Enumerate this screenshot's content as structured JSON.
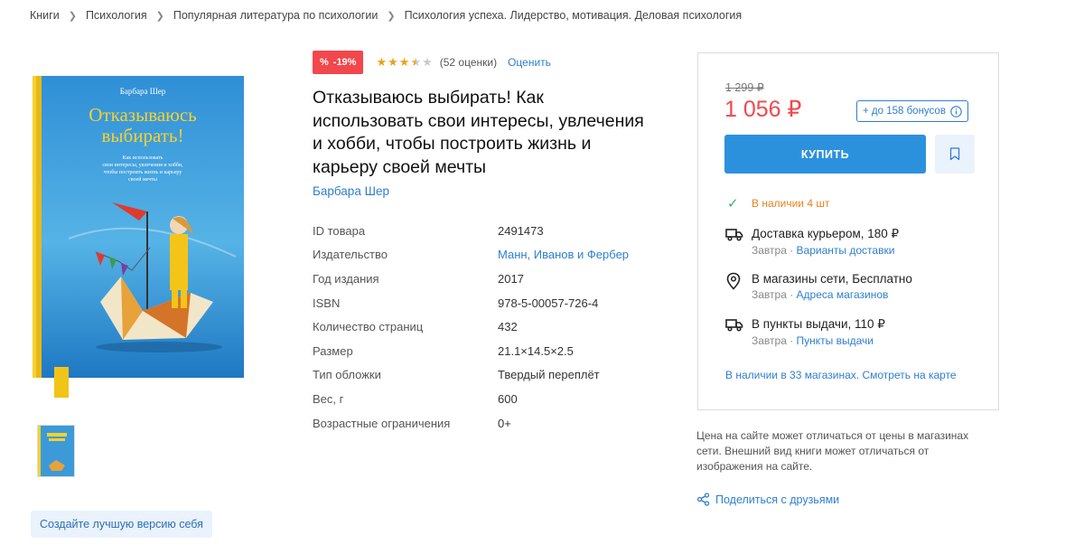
{
  "breadcrumbs": [
    "Книги",
    "Психология",
    "Популярная литература по психологии",
    "Психология успеха. Лидерство, мотивация. Деловая психология"
  ],
  "cover": {
    "author": "Барбара Шер",
    "title_line1": "Отказываюсь",
    "title_line2": "выбирать!",
    "subtitle_line1": "Как использовать",
    "subtitle_line2": "свои интересы, увлечения и хобби,",
    "subtitle_line3": "чтобы построить жизнь и карьеру",
    "subtitle_line4": "своей мечты"
  },
  "tag_button": "Создайте лучшую версию себя",
  "discount": "-19%",
  "rating": {
    "value": 3.5,
    "max": 5,
    "count_text": "(52 оценки)",
    "rate_label": "Оценить"
  },
  "title": "Отказываюсь выбирать! Как использовать свои интересы, увлечения и хобби, чтобы построить жизнь и карьеру своей мечты",
  "author": "Барбара Шер",
  "specs": [
    {
      "key": "ID товара",
      "value": "2491473",
      "link": false
    },
    {
      "key": "Издательство",
      "value": "Манн, Иванов и Фербер",
      "link": true
    },
    {
      "key": "Год издания",
      "value": "2017",
      "link": false
    },
    {
      "key": "ISBN",
      "value": "978-5-00057-726-4",
      "link": false
    },
    {
      "key": "Количество страниц",
      "value": "432",
      "link": false
    },
    {
      "key": "Размер",
      "value": "21.1×14.5×2.5",
      "link": false
    },
    {
      "key": "Тип обложки",
      "value": "Твердый переплёт",
      "link": false
    },
    {
      "key": "Вес, г",
      "value": "600",
      "link": false
    },
    {
      "key": "Возрастные ограничения",
      "value": "0+",
      "link": false
    }
  ],
  "buybox": {
    "old_price": "1 299 ₽",
    "price": "1 056 ₽",
    "bonus": "+ до 158 бонусов",
    "buy_label": "КУПИТЬ",
    "stock": "В наличии 4 шт",
    "delivery": [
      {
        "title": "Доставка курьером, 180 ₽",
        "when": "Завтра · ",
        "link": "Варианты доставки",
        "icon": "truck-icon"
      },
      {
        "title": "В магазины сети, Бесплатно",
        "when": "Завтра · ",
        "link": "Адреса магазинов",
        "icon": "location-pin-icon"
      },
      {
        "title": "В пункты выдачи, 110 ₽",
        "when": "Завтра · ",
        "link": "Пункты выдачи",
        "icon": "pickup-truck-icon"
      }
    ],
    "map_link": "В наличии в 33 магазинах. Смотреть на карте"
  },
  "note": "Цена на сайте может отличаться от цены в магазинах сети. Внешний вид книги может отличаться от изображения на сайте.",
  "share_label": "Поделиться с друзьями",
  "colors": {
    "accent": "#2e7fd0",
    "button": "#2c91dc",
    "price": "#f2474c",
    "stock": "#e8821b",
    "check": "#3bb07a"
  }
}
